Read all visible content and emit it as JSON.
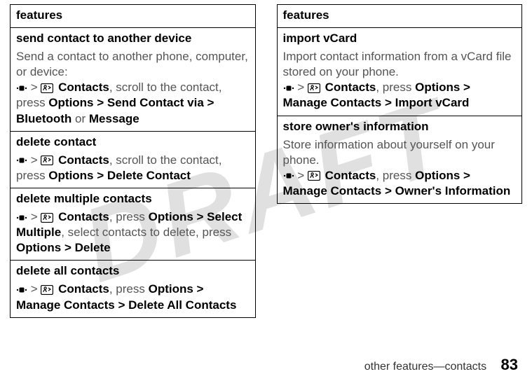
{
  "watermark": "DRAFT",
  "header": "features",
  "left": [
    {
      "title": "send contact to another device",
      "desc": "Send a contact to another phone, computer, or device:",
      "path_pre": "",
      "contacts": "Contacts",
      "path_mid": ", scroll to the contact, press ",
      "seq": "Options > Send Contact via > Bluetooth",
      "tail_plain": " or ",
      "tail_bold": "Message"
    },
    {
      "title": "delete contact",
      "desc": "",
      "contacts": "Contacts",
      "path_mid": ", scroll to the contact, press ",
      "seq": "Options > Delete Contact",
      "tail_plain": "",
      "tail_bold": ""
    },
    {
      "title": "delete multiple contacts",
      "desc": "",
      "contacts": "Contacts",
      "path_mid": ", press ",
      "seq": "Options > Select Multiple",
      "tail_plain": ", select contacts to delete, press ",
      "tail_bold": "Options > Delete"
    },
    {
      "title": "delete all contacts",
      "desc": "",
      "contacts": "Contacts",
      "path_mid": ", press ",
      "seq": "Options > Manage Contacts > Delete All Contacts",
      "tail_plain": "",
      "tail_bold": ""
    }
  ],
  "right": [
    {
      "title": "import vCard",
      "desc": "Import contact information from a vCard file stored on your phone.",
      "contacts": "Contacts",
      "path_mid": ", press ",
      "seq": "Options > Manage Contacts > Import vCard",
      "tail_plain": "",
      "tail_bold": ""
    },
    {
      "title": "store owner's information",
      "desc": "Store information about yourself on your phone.",
      "contacts": "Contacts",
      "path_mid": ", press ",
      "seq": "Options > Manage Contacts > Owner's Information",
      "tail_plain": "",
      "tail_bold": ""
    }
  ],
  "footer": {
    "section": "other features—contacts",
    "page": "83"
  }
}
